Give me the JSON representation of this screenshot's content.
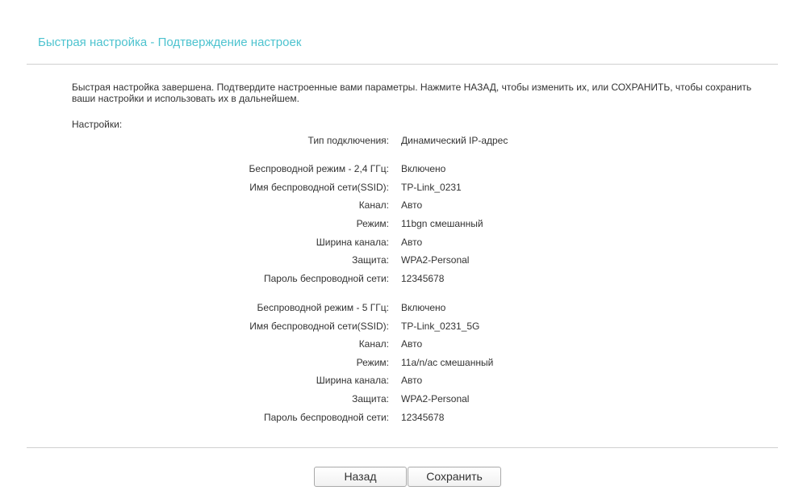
{
  "page": {
    "title": "Быстрая настройка - Подтверждение настроек",
    "intro": "Быстрая настройка завершена. Подтвердите настроенные вами параметры. Нажмите НАЗАД, чтобы изменить их, или СОХРАНИТЬ, чтобы сохранить ваши настройки и использовать их в дальнейшем.",
    "settings_label": "Настройки:"
  },
  "connection": {
    "type_label": "Тип подключения:",
    "type_value": "Динамический IP-адрес"
  },
  "wireless_24": {
    "mode_label": "Беспроводной режим - 2,4 ГГц:",
    "mode_value": "Включено",
    "ssid_label": "Имя беспроводной сети(SSID):",
    "ssid_value": "TP-Link_0231",
    "channel_label": "Канал:",
    "channel_value": "Авто",
    "rmode_label": "Режим:",
    "rmode_value": "11bgn смешанный",
    "width_label": "Ширина канала:",
    "width_value": "Авто",
    "security_label": "Защита:",
    "security_value": "WPA2-Personal",
    "password_label": "Пароль беспроводной сети:",
    "password_value": "12345678"
  },
  "wireless_5": {
    "mode_label": "Беспроводной режим - 5 ГГц:",
    "mode_value": "Включено",
    "ssid_label": "Имя беспроводной сети(SSID):",
    "ssid_value": "TP-Link_0231_5G",
    "channel_label": "Канал:",
    "channel_value": "Авто",
    "rmode_label": "Режим:",
    "rmode_value": "11a/n/ac смешанный",
    "width_label": "Ширина канала:",
    "width_value": "Авто",
    "security_label": "Защита:",
    "security_value": "WPA2-Personal",
    "password_label": "Пароль беспроводной сети:",
    "password_value": "12345678"
  },
  "buttons": {
    "back": "Назад",
    "save": "Сохранить"
  }
}
